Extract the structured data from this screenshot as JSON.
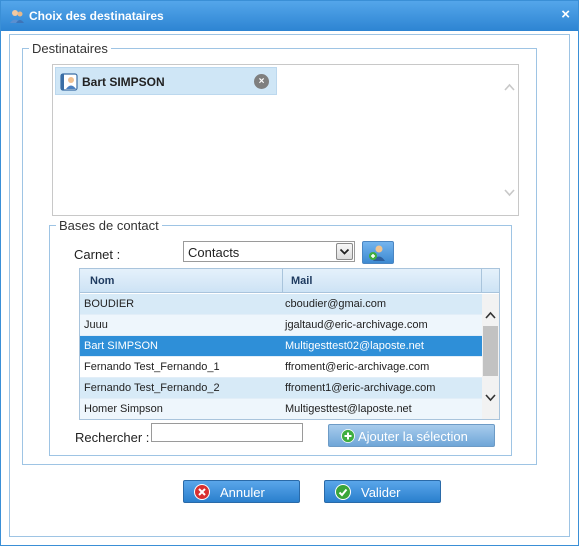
{
  "window": {
    "title": "Choix des destinataires",
    "close_symbol": "×"
  },
  "destinataires": {
    "legend": "Destinataires",
    "recipients": [
      {
        "name": "Bart SIMPSON",
        "icon": "contact-card-icon",
        "remove_symbol": "×"
      }
    ]
  },
  "bases": {
    "legend": "Bases de contact",
    "carnet_label": "Carnet :",
    "carnet_value": "Contacts",
    "table": {
      "columns": [
        "Nom",
        "Mail"
      ],
      "rows": [
        {
          "nom": "BOUDIER",
          "mail": "cboudier@gmai.com"
        },
        {
          "nom": "Juuu",
          "mail": "jgaltaud@eric-archivage.com"
        },
        {
          "nom": "Bart SIMPSON",
          "mail": "Multigesttest02@laposte.net",
          "selected": true
        },
        {
          "nom": "Fernando Test_Fernando_1",
          "mail": "ffroment@eric-archivage.com"
        },
        {
          "nom": "Fernando Test_Fernando_2",
          "mail": "ffroment1@eric-archivage.com"
        },
        {
          "nom": "Homer Simpson",
          "mail": "Multigesttest@laposte.net"
        }
      ]
    },
    "search_label": "Rechercher :",
    "search_value": "",
    "add_selection_label": "Ajouter la sélection"
  },
  "footer": {
    "cancel_label": "Annuler",
    "ok_label": "Valider"
  },
  "colors": {
    "titlebar": "#3b92de",
    "selected_row": "#2e8fd8",
    "chip_bg": "#cfe6f6",
    "cancel_icon": "#d83030",
    "ok_icon": "#3aa53a"
  }
}
